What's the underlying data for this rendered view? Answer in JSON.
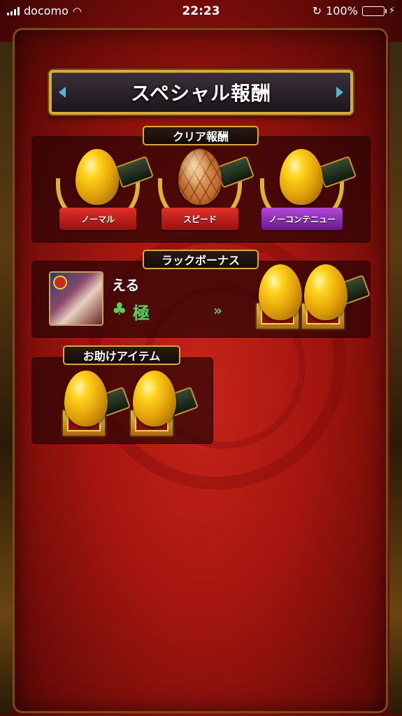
{
  "status_bar": {
    "carrier": "docomo",
    "time": "22:23",
    "battery": "100%"
  },
  "title": "スペシャル報酬",
  "clear_reward": {
    "label": "クリア報酬",
    "items": [
      {
        "ribbon": "ノーマル",
        "egg": "gold-egg-icon",
        "ribbon_color": "#c81e1e"
      },
      {
        "ribbon": "スピード",
        "egg": "hex-egg-icon",
        "ribbon_color": "#c81e1e"
      },
      {
        "ribbon": "ノーコンテニュー",
        "egg": "gold-egg-icon",
        "ribbon_color": "#8a2ab0"
      }
    ]
  },
  "luck_bonus": {
    "label": "ラックボーナス",
    "character_name": "える",
    "luck_value": "極",
    "arrow": "»"
  },
  "helper_item": {
    "label": "お助けアイテム"
  },
  "colors": {
    "accent_gold": "#d9a93c",
    "luck_green": "#5ad05a",
    "background_red": "#a4150f"
  }
}
